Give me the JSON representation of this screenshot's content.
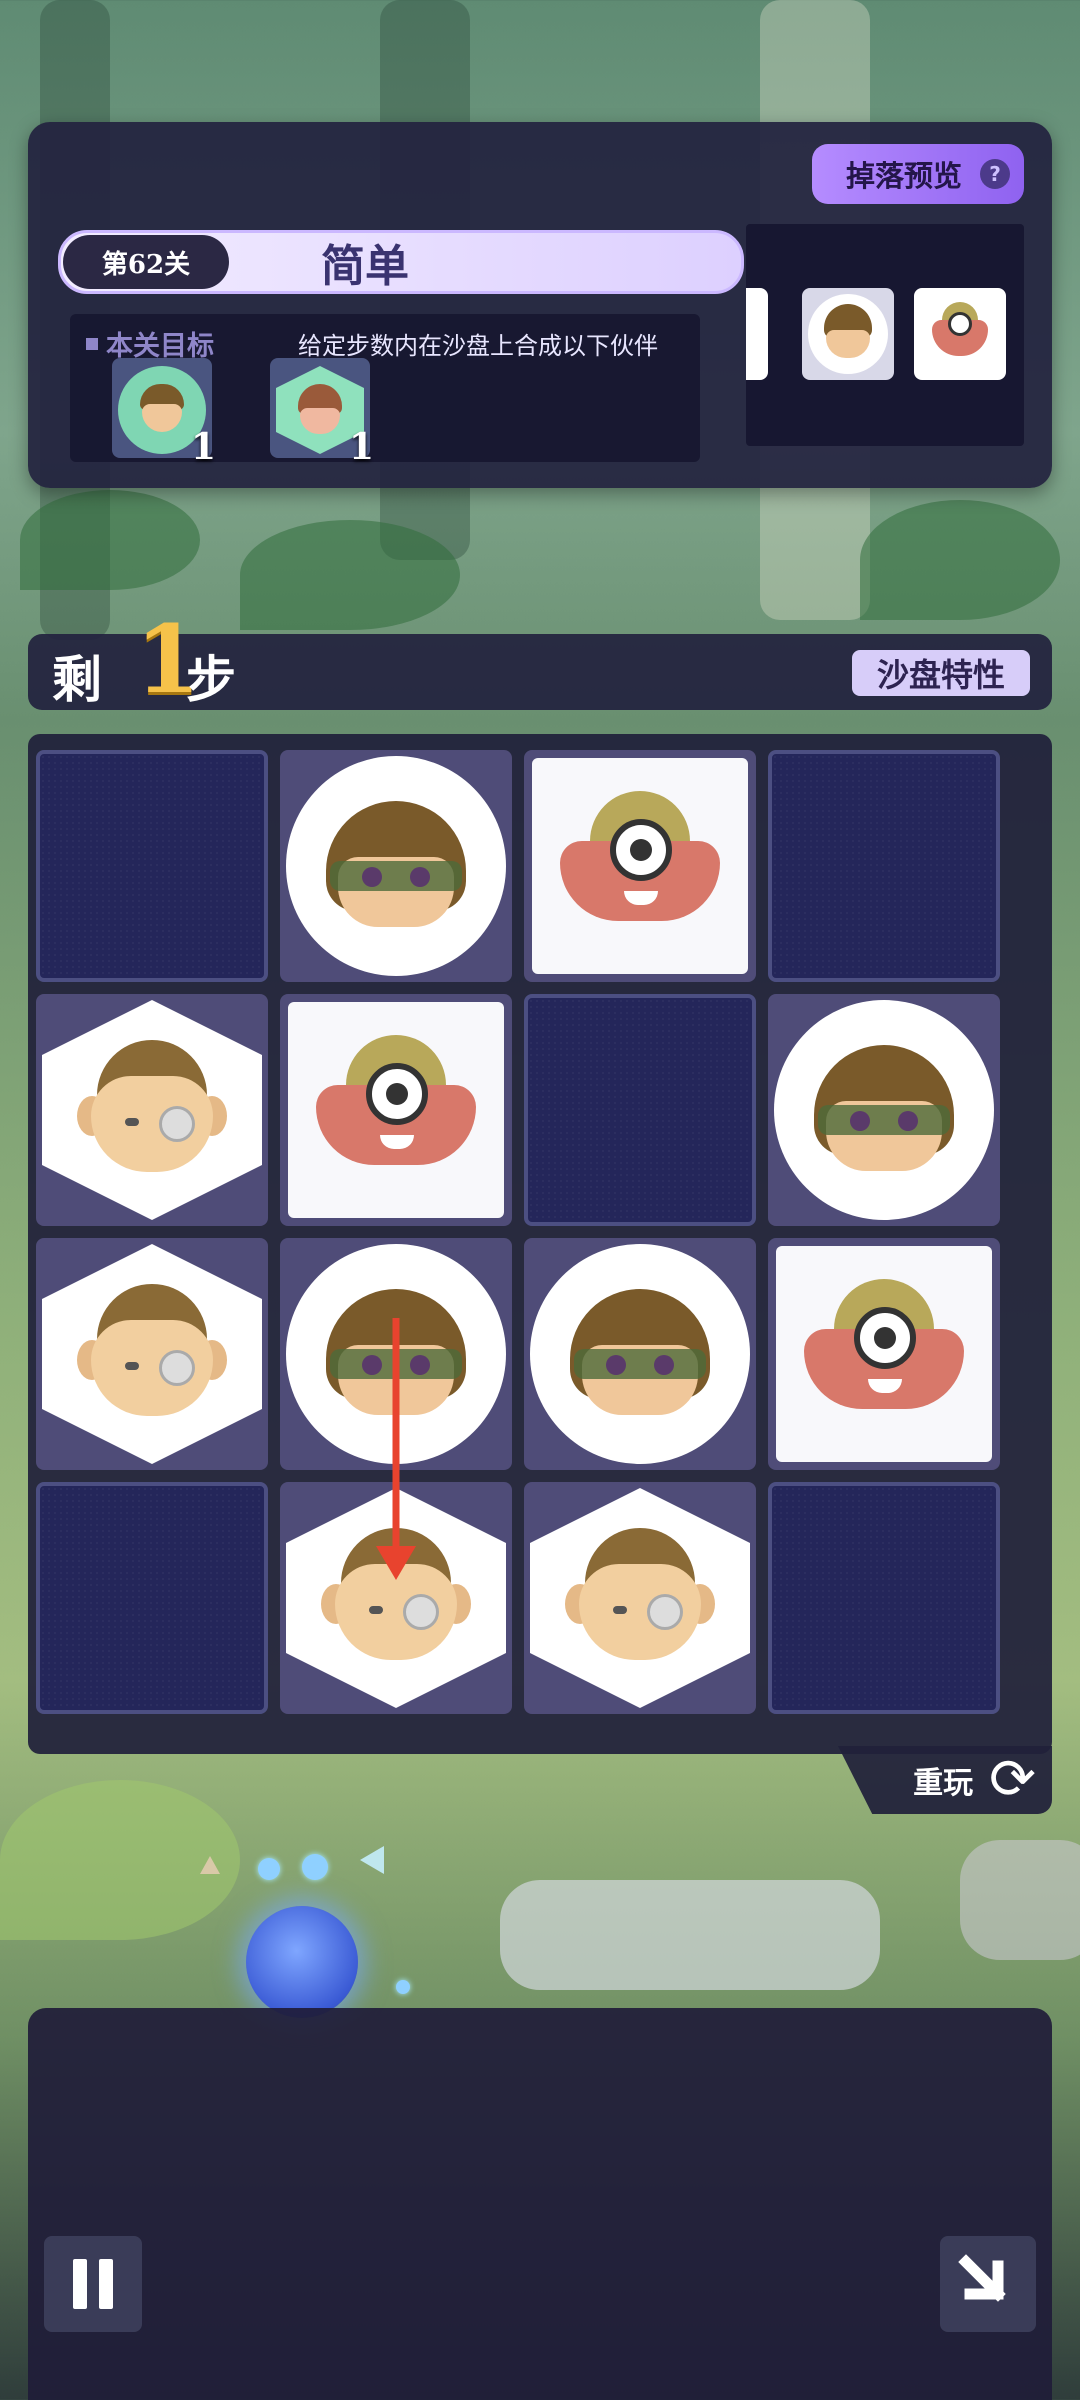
{
  "level": {
    "number_label": "第62关",
    "difficulty": "简单",
    "drop_preview_label": "掉落预览",
    "help_glyph": "?"
  },
  "goal": {
    "label": "本关目标",
    "description": "给定步数内在沙盘上合成以下伙伴",
    "items": [
      {
        "icon": "round-partner-icon",
        "count": "1"
      },
      {
        "icon": "hex-partner-icon",
        "count": "1"
      }
    ]
  },
  "steps": {
    "prefix": "剩",
    "number": "1",
    "suffix": "步",
    "sandbox_label": "沙盘特性"
  },
  "board": {
    "rows": 4,
    "cols": 4,
    "cells": [
      [
        "empty",
        "circle",
        "square",
        "empty"
      ],
      [
        "hex",
        "square",
        "empty",
        "circle"
      ],
      [
        "hex",
        "circle",
        "circle",
        "square"
      ],
      [
        "empty",
        "hex",
        "hex",
        "empty"
      ]
    ],
    "hint_arrow": {
      "from": [
        2,
        1
      ],
      "to": [
        3,
        1
      ],
      "color": "#e8432e"
    }
  },
  "replay": {
    "label": "重玩",
    "icon": "refresh-icon"
  },
  "colors": {
    "panel": "#22223e",
    "accent": "#8f62f0",
    "steps_number": "#f6c24a"
  }
}
